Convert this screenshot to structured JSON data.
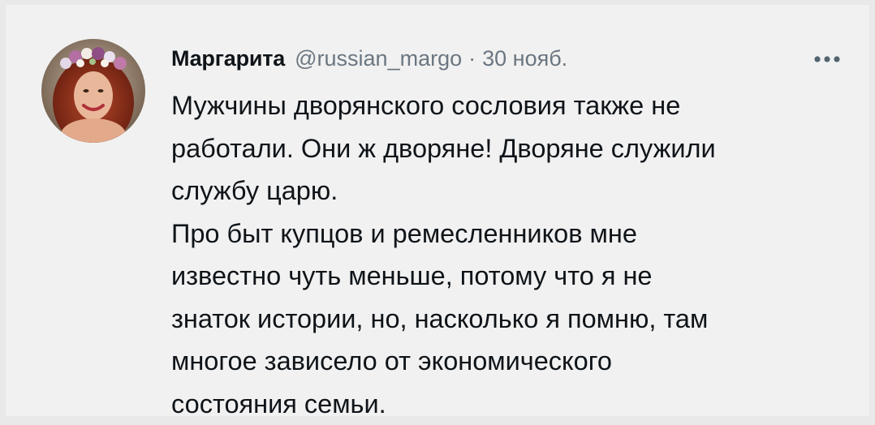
{
  "tweet": {
    "author": {
      "display_name": "Маргарита",
      "handle": "@russian_margo"
    },
    "separator": "·",
    "date": "30 нояб.",
    "more_icon": "more-horizontal-icon",
    "text_lines": [
      "Мужчины дворянского сословия также не",
      "работали. Они ж дворяне! Дворяне служили",
      "службу царю.",
      "Про быт купцов и ремесленников мне",
      "известно чуть меньше, потому что я не",
      "знаток истории, но, насколько я помню, там",
      "многое зависело от экономического",
      "состояния семьи."
    ]
  },
  "colors": {
    "background": "#f1f1f1",
    "text_primary": "#0f1419",
    "text_secondary": "#6b7680"
  }
}
